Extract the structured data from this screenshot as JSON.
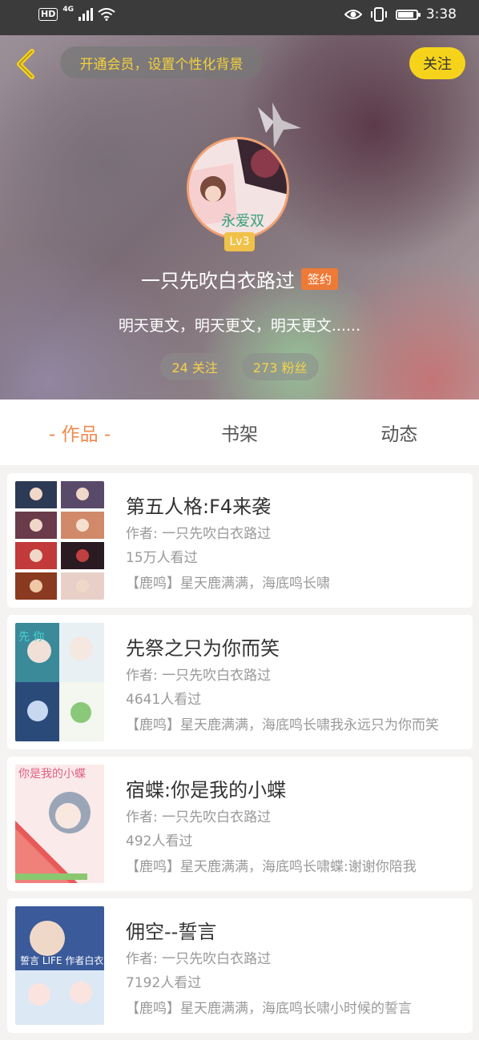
{
  "status_bar": {
    "hd": "HD",
    "network": "4G",
    "time": "3:38",
    "battery_level": 0.9
  },
  "header": {
    "vip_text": "开通会员，设置个性化背景",
    "follow_label": "关注",
    "avatar_text": "永爱双",
    "level": "Lv3",
    "username": "一只先吹白衣路过",
    "sign_badge": "签约",
    "bio": "明天更文，明天更文，明天更文......",
    "following": "24 关注",
    "fans": "273 粉丝"
  },
  "tabs": [
    {
      "label": "- 作品 -",
      "active": true
    },
    {
      "label": "书架",
      "active": false
    },
    {
      "label": "动态",
      "active": false
    }
  ],
  "books": [
    {
      "title": "第五人格:F4来袭",
      "author": "作者: 一只先吹白衣路过",
      "views": "15万人看过",
      "desc": "【鹿鸣】星天鹿满满，海底鸣长啸"
    },
    {
      "title": "先祭之只为你而笑",
      "author": "作者: 一只先吹白衣路过",
      "views": "4641人看过",
      "desc": "【鹿鸣】星天鹿满满，海底鸣长啸我永远只为你而笑"
    },
    {
      "title": "宿蝶:你是我的小蝶",
      "author": "作者: 一只先吹白衣路过",
      "views": "492人看过",
      "desc": "【鹿鸣】星天鹿满满，海底鸣长啸蝶:谢谢你陪我"
    },
    {
      "title": "佣空--誓言",
      "author": "作者: 一只先吹白衣路过",
      "views": "7192人看过",
      "desc": "【鹿鸣】星天鹿满满，海底鸣长啸小时候的誓言"
    }
  ],
  "covers": [
    {
      "text": ""
    },
    {
      "text": "先 你"
    },
    {
      "text": "你是我的小蝶"
    },
    {
      "text": "誓言 LIFE 作者白衣"
    }
  ]
}
